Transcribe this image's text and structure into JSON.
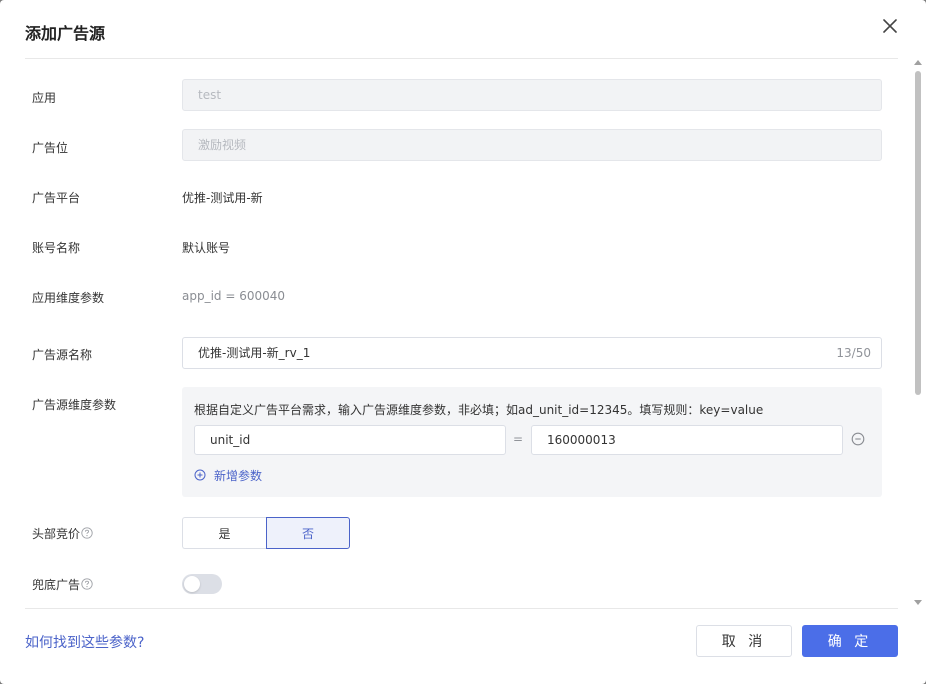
{
  "dialog": {
    "title": "添加广告源"
  },
  "form": {
    "app": {
      "label": "应用",
      "value": "test"
    },
    "ad_slot": {
      "label": "广告位",
      "value": "激励视频"
    },
    "platform": {
      "label": "广告平台",
      "value": "优推-测试用-新"
    },
    "account": {
      "label": "账号名称",
      "value": "默认账号"
    },
    "app_params": {
      "label": "应用维度参数",
      "value": "app_id = 600040"
    },
    "source_name": {
      "label": "广告源名称",
      "value": "优推-测试用-新_rv_1",
      "counter": "13/50"
    },
    "source_params": {
      "label": "广告源维度参数",
      "hint": "根据自定义广告平台需求，输入广告源维度参数，非必填；如ad_unit_id=12345。填写规则：key=value",
      "rows": [
        {
          "key": "unit_id",
          "eq": "=",
          "value": "160000013"
        }
      ],
      "add_label": "新增参数"
    },
    "header_bidding": {
      "label": "头部竞价",
      "options": [
        "是",
        "否"
      ],
      "selected": "否"
    },
    "fallback_ad": {
      "label": "兜底广告",
      "enabled": false
    }
  },
  "footer": {
    "help_link": "如何找到这些参数?",
    "cancel_label": "取 消",
    "ok_label": "确 定"
  },
  "colors": {
    "accent": "#4b6ee8",
    "link": "#4b63c9"
  }
}
